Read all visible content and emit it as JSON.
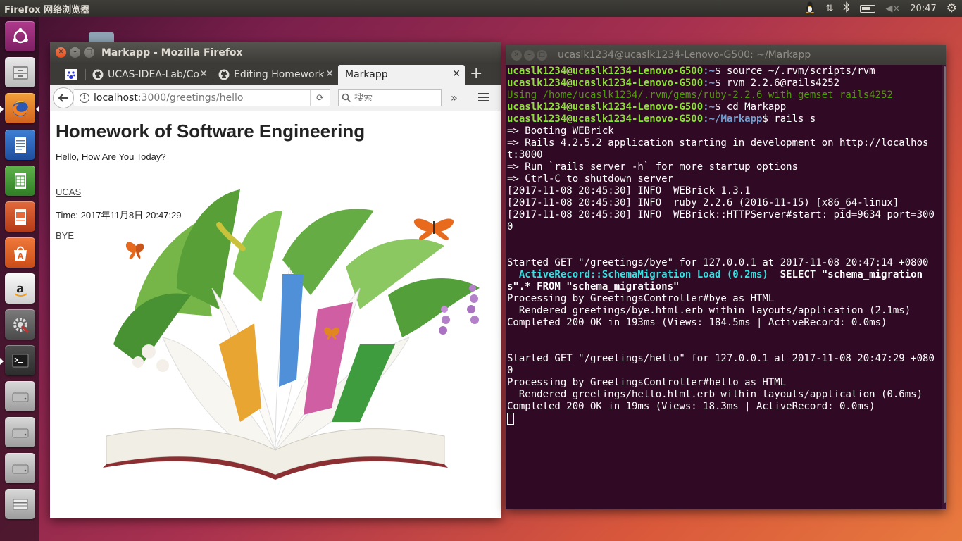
{
  "topbar": {
    "app_title": "Firefox 网络浏览器",
    "clock": "20:47",
    "tray_icons": [
      "tux-icon",
      "network-icon",
      "bluetooth-icon",
      "battery-icon",
      "volume-muted-icon",
      "gear-icon"
    ]
  },
  "launcher": {
    "items": [
      "ubuntu-dash",
      "files",
      "firefox",
      "libreoffice-writer",
      "libreoffice-calc",
      "libreoffice-impress",
      "ubuntu-software",
      "amazon",
      "system-settings",
      "terminal",
      "drive-1",
      "drive-2",
      "drive-3",
      "trash"
    ]
  },
  "firefox": {
    "window_title": "Markapp - Mozilla Firefox",
    "tabs": [
      {
        "label": ""
      },
      {
        "label": "UCAS-IDEA-Lab/Co"
      },
      {
        "label": "Editing Homework"
      },
      {
        "label": "Markapp"
      }
    ],
    "new_tab": "+",
    "url_host": "localhost",
    "url_path": ":3000/greetings/hello",
    "search_placeholder": "搜索",
    "overflow": "»",
    "page": {
      "heading": "Homework of Software Engineering",
      "greeting": "Hello, How Are You Today?",
      "link_ucas": "UCAS",
      "time": "Time: 2017年11月8日 20:47:29",
      "link_bye": "BYE"
    }
  },
  "terminal": {
    "window_title": "ucaslk1234@ucaslk1234-Lenovo-G500: ~/Markapp",
    "prompt_user": "ucaslk1234@ucaslk1234-Lenovo-G500",
    "prompt_home": ":~",
    "prompt_markapp": ":~/Markapp",
    "cmd1": "$ source ~/.rvm/scripts/rvm",
    "cmd2": "$ rvm 2.2.6@rails4252",
    "using": "Using /home/ucaslk1234/.rvm/gems/ruby-2.2.6 with gemset rails4252",
    "cmd3": "$ cd Markapp",
    "cmd4": "$ rails s",
    "log1": "=> Booting WEBrick\n=> Rails 4.2.5.2 application starting in development on http://localhost:3000\n=> Run `rails server -h` for more startup options\n=> Ctrl-C to shutdown server\n[2017-11-08 20:45:30] INFO  WEBrick 1.3.1\n[2017-11-08 20:45:30] INFO  ruby 2.2.6 (2016-11-15) [x86_64-linux]\n[2017-11-08 20:45:30] INFO  WEBrick::HTTPServer#start: pid=9634 port=3000\n\n\nStarted GET \"/greetings/bye\" for 127.0.0.1 at 2017-11-08 20:47:14 +0800",
    "ar_label": "  ActiveRecord::SchemaMigration Load (0.2ms)",
    "ar_sql": "  SELECT \"schema_migrations\".* FROM \"schema_migrations\"",
    "log2": "Processing by GreetingsController#bye as HTML\n  Rendered greetings/bye.html.erb within layouts/application (2.1ms)\nCompleted 200 OK in 193ms (Views: 184.5ms | ActiveRecord: 0.0ms)\n\n\nStarted GET \"/greetings/hello\" for 127.0.0.1 at 2017-11-08 20:47:29 +0800\nProcessing by GreetingsController#hello as HTML\n  Rendered greetings/hello.html.erb within layouts/application (0.6ms)\nCompleted 200 OK in 19ms (Views: 18.3ms | ActiveRecord: 0.0ms)"
  }
}
